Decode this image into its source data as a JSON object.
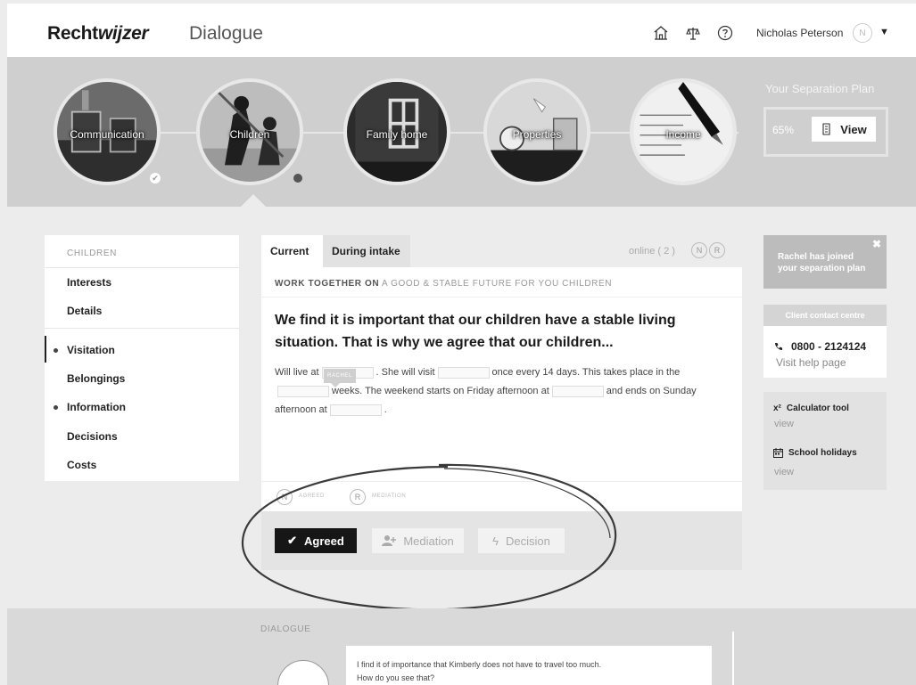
{
  "header": {
    "brand_bold": "Recht",
    "brand_italic": "wijzer",
    "app_title": "Dialogue",
    "icons": [
      "home-icon",
      "scales-icon",
      "help-icon"
    ],
    "user_name": "Nicholas Peterson",
    "user_initial": "N"
  },
  "steps": [
    {
      "label": "Communication",
      "status": "completed"
    },
    {
      "label": "Children",
      "status": "current"
    },
    {
      "label": "Family home",
      "status": "open"
    },
    {
      "label": "Properties",
      "status": "open"
    },
    {
      "label": "Income",
      "status": "open"
    }
  ],
  "plan": {
    "title": "Your Separation Plan",
    "progress_label": "65%",
    "progress": 0.65,
    "view_label": "View"
  },
  "sidebar": {
    "heading": "CHILDREN",
    "items": [
      {
        "label": "Interests"
      },
      {
        "label": "Details"
      },
      {
        "label": "Visitation",
        "active": true,
        "marked": true
      },
      {
        "label": "Belongings"
      },
      {
        "label": "Information",
        "marked": true
      },
      {
        "label": "Decisions"
      },
      {
        "label": "Costs"
      }
    ]
  },
  "card": {
    "tabs": [
      {
        "label": "Current",
        "active": true
      },
      {
        "label": "During intake",
        "active": false
      }
    ],
    "online_label": "online ( 2 )",
    "online_users": [
      "N",
      "R"
    ],
    "subtitle_strong": "WORK TOGETHER ON",
    "subtitle_rest": "A GOOD & STABLE FUTURE FOR YOU CHILDREN",
    "heading": "We find it is important that our children have a stable living situation. That is why we agree that our children...",
    "text": {
      "p1": "Will live at",
      "p2": ". She will visit",
      "p3": "once every 14 days. This takes place in the",
      "p4": "weeks. The weekend starts on Friday afternoon at",
      "p5": "and ends on Sunday afternoon at",
      "p6": "."
    },
    "tag_label": "RACHEL",
    "status": [
      {
        "initial": "N",
        "label": "AGREED"
      },
      {
        "initial": "R",
        "label": "MEDIATION"
      }
    ],
    "actions": {
      "agreed": "Agreed",
      "mediation": "Mediation",
      "decision": "Decision"
    }
  },
  "notice": {
    "text": "Rachel has joined your separation plan",
    "close": "✖"
  },
  "contact": {
    "heading": "Client contact centre",
    "phone": "0800 - 2124124",
    "help_link": "Visit help page"
  },
  "tools": [
    {
      "label": "Calculator tool",
      "link": "view",
      "icon": "calculator-icon"
    },
    {
      "label": "School holidays",
      "link": "view",
      "icon": "calendar-icon"
    }
  ],
  "dialogue": {
    "title": "DIALOGUE",
    "line1": "I find it of importance that Kimberly does not have to travel too much.",
    "line2": "How do you see that?"
  }
}
